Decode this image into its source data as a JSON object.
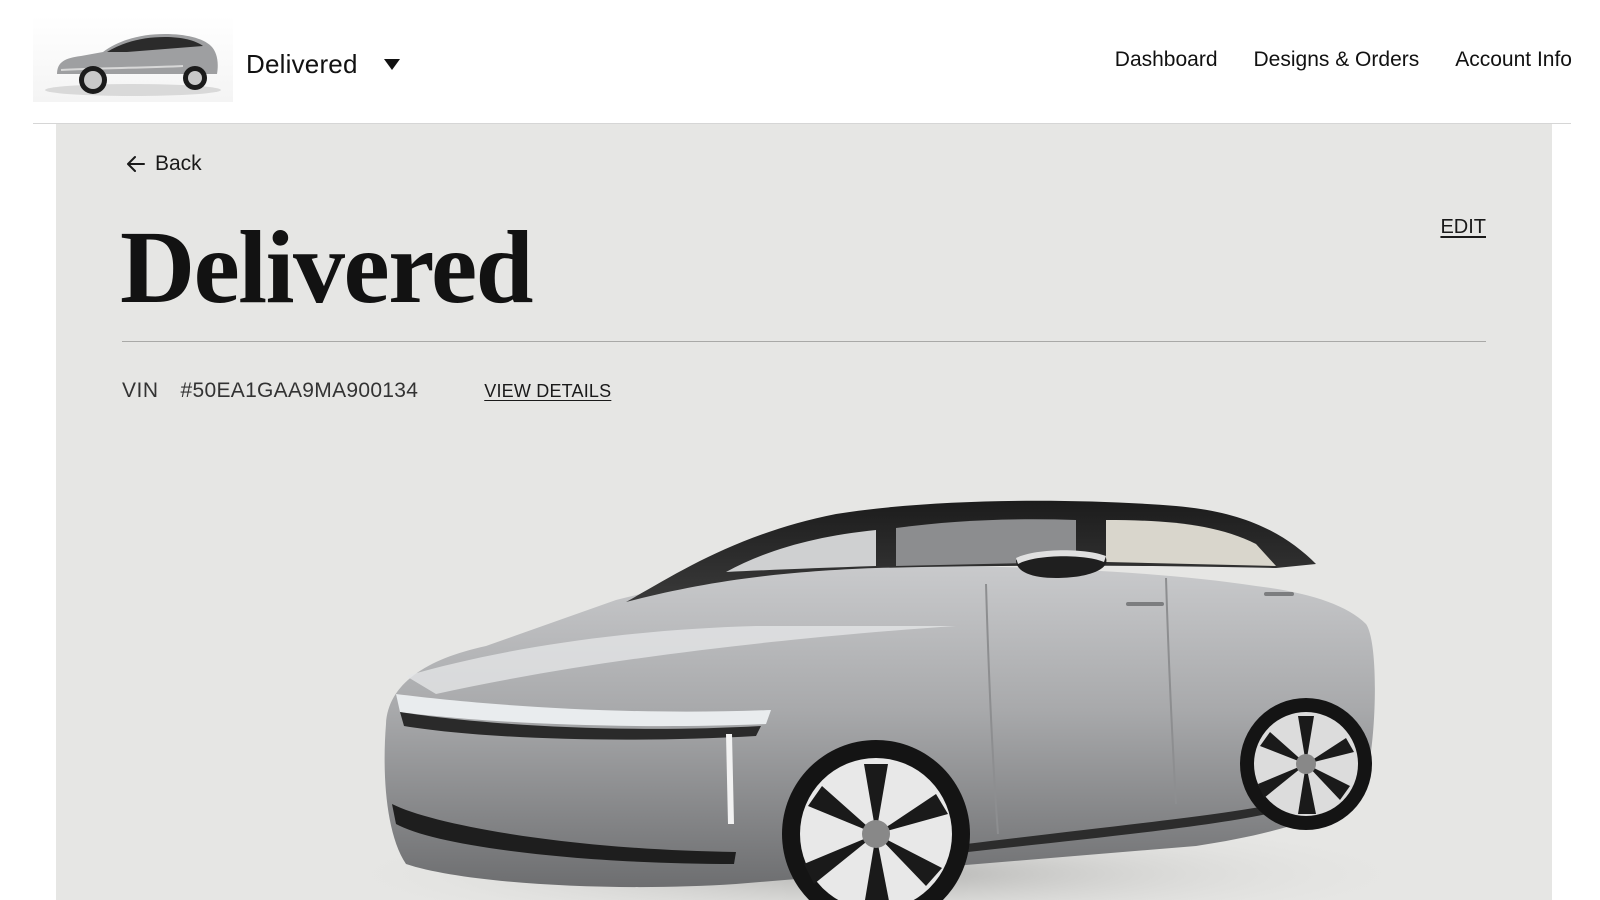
{
  "header": {
    "vehicle_selector": {
      "label": "Delivered"
    },
    "nav": [
      {
        "label": "Dashboard"
      },
      {
        "label": "Designs & Orders"
      },
      {
        "label": "Account Info"
      }
    ]
  },
  "main": {
    "back_label": "Back",
    "edit_label": "EDIT",
    "title": "Delivered",
    "vin_label": "VIN",
    "vin_value": "#50EA1GAA9MA900134",
    "view_details_label": "VIEW DETAILS"
  },
  "icons": {
    "back": "arrow-left-icon",
    "dropdown": "caret-down-icon"
  },
  "colors": {
    "panel_background": "#e6e6e4",
    "text": "#1a1a1a",
    "car_body": "#a9aaac"
  }
}
